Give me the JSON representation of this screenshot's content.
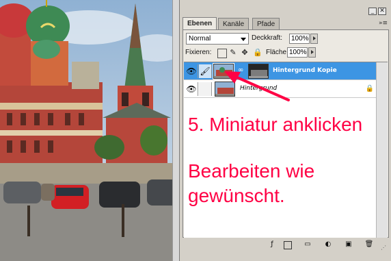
{
  "palette": {
    "tabs": [
      "Ebenen",
      "Kanäle",
      "Pfade"
    ],
    "active_tab": "Ebenen",
    "blend_mode": "Normal",
    "opacity_label": "Deckkraft:",
    "opacity_value": "100%",
    "lock_label": "Fixieren:",
    "fill_label": "Fläche",
    "fill_value": "100%",
    "layers": [
      {
        "name": "Hintergrund Kopie",
        "selected": true
      },
      {
        "name": "Hintergrund",
        "selected": false,
        "locked": true
      }
    ]
  },
  "annotation": {
    "line1": "5. Miniatur anklicken",
    "line2": "Bearbeiten wie",
    "line3": "gewünscht."
  },
  "colors": {
    "annotation": "#ff0044",
    "selection": "#3d95e3",
    "arrow": "#ff0044"
  },
  "icons": {
    "visibility": "eye-icon",
    "paint": "brush-icon",
    "link": "chain-icon",
    "lock": "lock-icon"
  }
}
